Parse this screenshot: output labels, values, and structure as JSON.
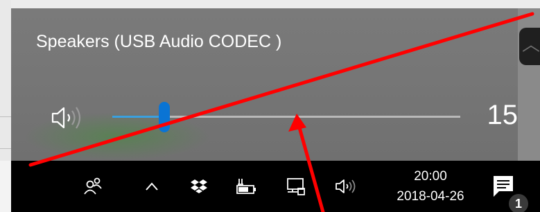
{
  "flyout": {
    "device_name": "Speakers (USB Audio CODEC )",
    "volume": 15,
    "volume_fraction": 0.15,
    "speaker_icon": "speaker-volume-icon",
    "expand_icon": "chevron-up-icon"
  },
  "taskbar": {
    "icons": [
      {
        "name": "people-icon"
      },
      {
        "name": "chevron-up-icon"
      },
      {
        "name": "dropbox-icon"
      },
      {
        "name": "battery-charging-icon"
      },
      {
        "name": "network-icon"
      },
      {
        "name": "speaker-icon"
      }
    ],
    "clock": {
      "time": "20:00",
      "date": "2018-04-26"
    },
    "notifications": {
      "icon": "action-center-icon",
      "count": "1"
    }
  },
  "colors": {
    "flyout_bg": "#777777",
    "accent": "#0a74d4",
    "slider_fill": "#3aa0e0",
    "taskbar_bg": "#000000",
    "annotation": "#ff0000"
  }
}
